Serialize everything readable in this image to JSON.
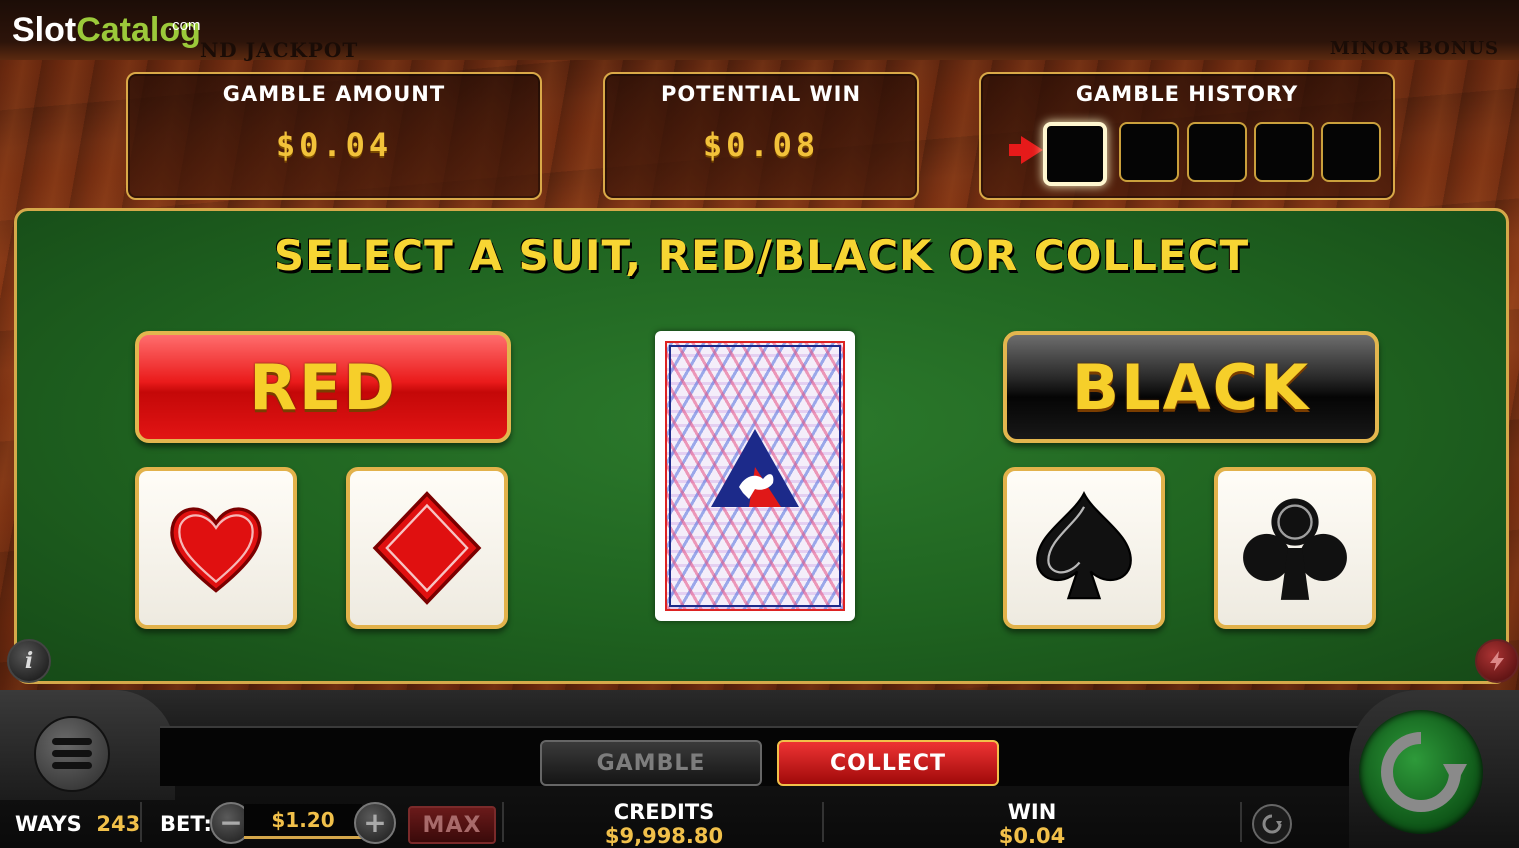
{
  "branding": {
    "logo_part1": "Slot",
    "logo_part2": "Catalog",
    "logo_suffix": ".com"
  },
  "top_strip": {
    "left_text": "ND JACKPOT",
    "right_text": "MINOR BONUS"
  },
  "gamble_amount": {
    "title": "GAMBLE AMOUNT",
    "value": "$0.04"
  },
  "potential_win": {
    "title": "POTENTIAL WIN",
    "value": "$0.08"
  },
  "gamble_history": {
    "title": "GAMBLE HISTORY",
    "slots": 5,
    "current_index": 0
  },
  "instruction": "SELECT A SUIT, RED/BLACK OR COLLECT",
  "choices": {
    "red_label": "RED",
    "black_label": "BLACK"
  },
  "suits": [
    {
      "name": "heart",
      "color": "#e01010"
    },
    {
      "name": "diamond",
      "color": "#e01010"
    },
    {
      "name": "spade",
      "color": "#111111"
    },
    {
      "name": "club",
      "color": "#111111"
    }
  ],
  "icons": {
    "info": "i",
    "info_icon": "info-icon",
    "autoplay_icon": "lightning-icon",
    "menu_icon": "hamburger-icon",
    "spin_icon": "spin-arrow-icon",
    "refresh_icon": "refresh-icon"
  },
  "actions": {
    "gamble_label": "GAMBLE",
    "collect_label": "COLLECT"
  },
  "footer": {
    "ways_label": "WAYS",
    "ways_value": "243",
    "bet_label": "BET:",
    "bet_value": "$1.20",
    "minus": "−",
    "plus": "+",
    "max_label": "MAX",
    "credits_label": "CREDITS",
    "credits_value": "$9,998.80",
    "win_label": "WIN",
    "win_value": "$0.04"
  },
  "colors": {
    "accent_gold": "#f1c04a",
    "felt_green": "#1f6320",
    "red_button": "#e21414",
    "collect_red": "#c41414"
  }
}
